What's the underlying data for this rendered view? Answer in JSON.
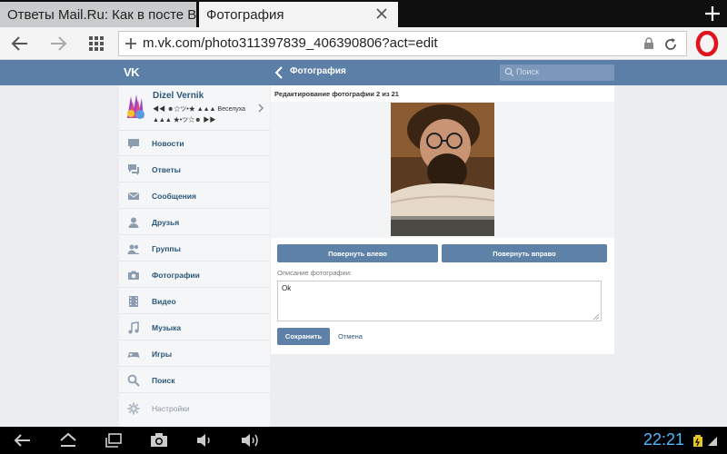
{
  "browser": {
    "tabs": [
      {
        "title": "Ответы Mail.Ru: Как в посте Ві",
        "active": false
      },
      {
        "title": "Фотография",
        "active": true
      }
    ],
    "url": "m.vk.com/photo311397839_406390806?act=edit"
  },
  "vk": {
    "logo": "VK",
    "page_title": "Фотография",
    "search_placeholder": "Поиск"
  },
  "profile": {
    "name": "Dizel Vernik",
    "status_line1": "◀◀ ☻☆ツ•★ ▲▲▲ Веселуха",
    "status_line2": "▲▲▲ ★•ツ☆☻ ▶▶"
  },
  "menu": [
    {
      "label": "Новости",
      "icon": "news-icon"
    },
    {
      "label": "Ответы",
      "icon": "replies-icon"
    },
    {
      "label": "Сообщения",
      "icon": "messages-icon"
    },
    {
      "label": "Друзья",
      "icon": "friends-icon"
    },
    {
      "label": "Группы",
      "icon": "groups-icon"
    },
    {
      "label": "Фотографии",
      "icon": "camera-icon"
    },
    {
      "label": "Видео",
      "icon": "video-icon"
    },
    {
      "label": "Музыка",
      "icon": "music-icon"
    },
    {
      "label": "Игры",
      "icon": "gamepad-icon"
    },
    {
      "label": "Поиск",
      "icon": "search-icon"
    },
    {
      "label": "Настройки",
      "icon": "gear-icon"
    }
  ],
  "editor": {
    "heading": "Редактирование фотографии 2 из 21",
    "rotate_left": "Повернуть влево",
    "rotate_right": "Повернуть вправо",
    "description_label": "Описание фотографии:",
    "description_value": "Ok",
    "save": "Сохранить",
    "cancel": "Отмена"
  },
  "system": {
    "clock": "22:21"
  },
  "colors": {
    "vk_header": "#5b7fa6",
    "vk_button": "#5e81a8",
    "opera_red": "#e0141e",
    "clock_blue": "#4fb8ff"
  }
}
